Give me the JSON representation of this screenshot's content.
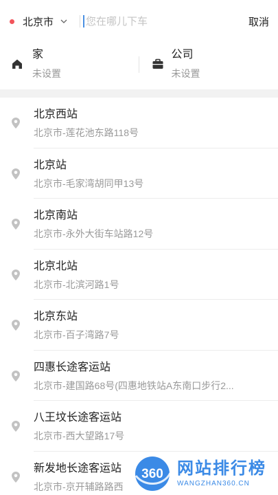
{
  "top_bar": {
    "city": "北京市",
    "search_placeholder": "您在哪儿下车",
    "cancel_label": "取消"
  },
  "shortcuts": {
    "home": {
      "title": "家",
      "subtitle": "未设置"
    },
    "company": {
      "title": "公司",
      "subtitle": "未设置"
    }
  },
  "places": [
    {
      "name": "北京西站",
      "address": "北京市-莲花池东路118号"
    },
    {
      "name": "北京站",
      "address": "北京市-毛家湾胡同甲13号"
    },
    {
      "name": "北京南站",
      "address": "北京市-永外大街车站路12号"
    },
    {
      "name": "北京北站",
      "address": "北京市-北滨河路1号"
    },
    {
      "name": "北京东站",
      "address": "北京市-百子湾路7号"
    },
    {
      "name": "四惠长途客运站",
      "address": "北京市-建国路68号(四惠地铁站A东南口步行2..."
    },
    {
      "name": "八王坟长途客运站",
      "address": "北京市-西大望路17号"
    },
    {
      "name": "新发地长途客运站",
      "address": "北京市-京开辅路路西"
    }
  ],
  "watermark": {
    "logo_text": "360",
    "title": "网站排行榜",
    "url": "WANGZHAN360.CN"
  },
  "colors": {
    "city_dot": "#f2545b",
    "caret": "#4a90e2",
    "watermark": "#3b8ae6"
  }
}
